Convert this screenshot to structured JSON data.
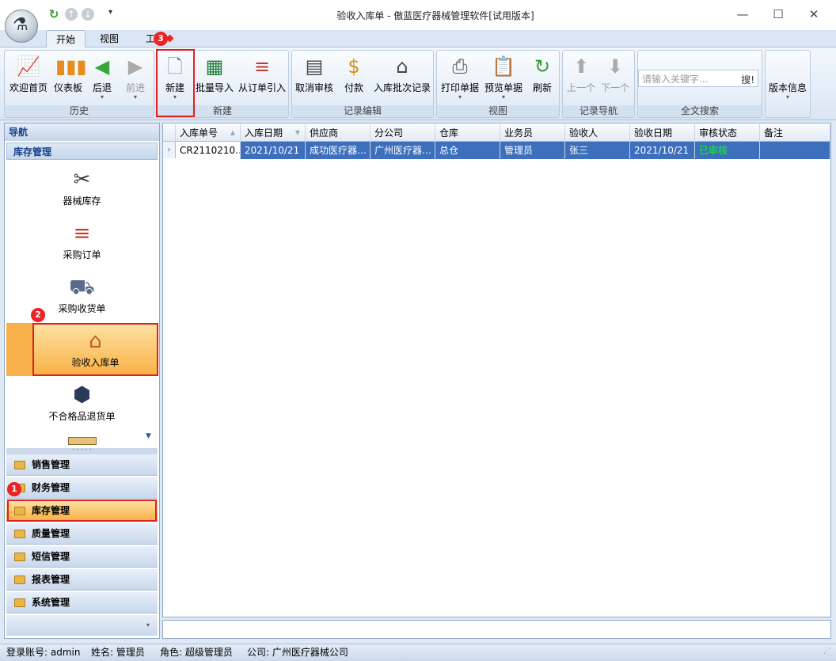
{
  "window": {
    "title": "验收入库单 - 傲蓝医疗器械管理软件[试用版本]",
    "minimize": "—",
    "maximize": "☐",
    "close": "✕"
  },
  "qat": {
    "refresh": "↻",
    "up": "↑",
    "down": "↓",
    "more": "▾"
  },
  "tabs": [
    "开始",
    "视图",
    "工"
  ],
  "badges": {
    "one": "1",
    "two": "2",
    "three": "3"
  },
  "ribbon": {
    "groups": {
      "history": "历史",
      "new": "新建",
      "record_edit": "记录编辑",
      "view": "视图",
      "record_nav": "记录导航",
      "search": "全文搜索"
    },
    "buttons": {
      "welcome": "欢迎首页",
      "dashboard": "仪表板",
      "back": "后退",
      "forward": "前进",
      "new": "新建",
      "batch_import": "批量导入",
      "from_order": "从订单引入",
      "cancel_audit": "取消审核",
      "payment": "付款",
      "batch_record": "入库批次记录",
      "print": "打印单据",
      "preview": "预览单据",
      "refresh": "刷新",
      "prev": "上一个",
      "next": "下一个",
      "version": "版本信息"
    },
    "search": {
      "placeholder": "请输入关键字...",
      "go": "搜!"
    }
  },
  "nav": {
    "title": "导航",
    "section": "库存管理",
    "items": [
      "器械库存",
      "采购订单",
      "采购收货单",
      "验收入库单",
      "不合格品退货单"
    ],
    "sections": [
      "销售管理",
      "财务管理",
      "库存管理",
      "质量管理",
      "短信管理",
      "报表管理",
      "系统管理"
    ]
  },
  "grid": {
    "columns": [
      "入库单号",
      "入库日期",
      "供应商",
      "分公司",
      "仓库",
      "业务员",
      "验收人",
      "验收日期",
      "审核状态",
      "备注"
    ],
    "rows": [
      [
        "CR2110210…",
        "2021/10/21",
        "成功医疗器…",
        "广州医疗器…",
        "总仓",
        "管理员",
        "张三",
        "2021/10/21",
        "已审核",
        ""
      ]
    ]
  },
  "status": {
    "account": "登录账号: admin",
    "name": "姓名: 管理员",
    "role": "角色: 超级管理员",
    "company": "公司: 广州医疗器械公司"
  },
  "colors": {
    "accent": "#f9b042",
    "highlight": "#e02020",
    "approved": "#138a1c"
  }
}
